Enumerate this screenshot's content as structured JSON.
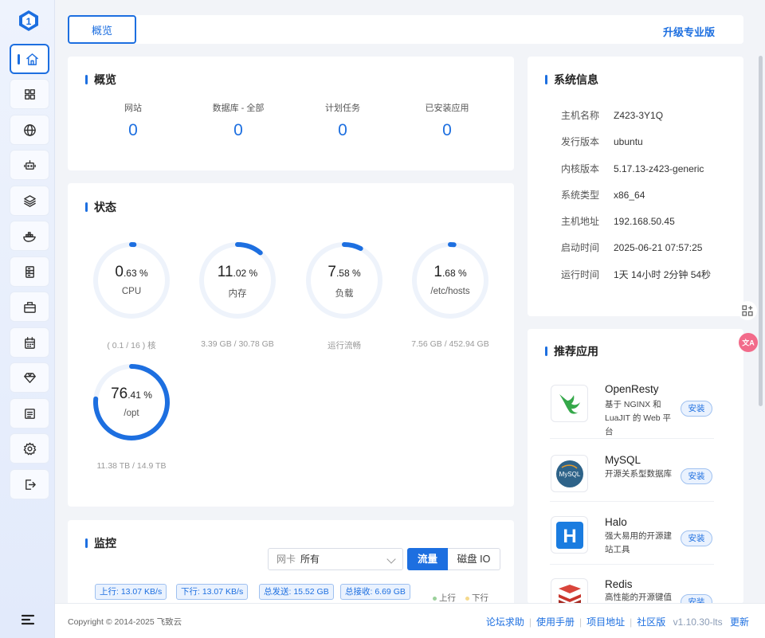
{
  "header": {
    "tab_overview": "概览",
    "upgrade": "升级专业版"
  },
  "overview": {
    "title": "概览",
    "stats": [
      {
        "label": "网站",
        "value": "0"
      },
      {
        "label": "数据库 - 全部",
        "value": "0"
      },
      {
        "label": "计划任务",
        "value": "0"
      },
      {
        "label": "已安装应用",
        "value": "0"
      }
    ]
  },
  "status": {
    "title": "状态",
    "gauges": [
      {
        "int": "0",
        "dec": ".63 %",
        "name": "CPU",
        "sub": "( 0.1 / 16 ) 核",
        "percent": 0.63
      },
      {
        "int": "11",
        "dec": ".02 %",
        "name": "内存",
        "sub": "3.39 GB / 30.78 GB",
        "percent": 11.02
      },
      {
        "int": "7",
        "dec": ".58 %",
        "name": "负载",
        "sub": "运行流畅",
        "percent": 7.58
      },
      {
        "int": "1",
        "dec": ".68 %",
        "name": "/etc/hosts",
        "sub": "7.56 GB / 452.94 GB",
        "percent": 1.68
      },
      {
        "int": "76",
        "dec": ".41 %",
        "name": "/opt",
        "sub": "11.38 TB / 14.9 TB",
        "percent": 76.41
      }
    ]
  },
  "sysinfo": {
    "title": "系统信息",
    "rows": [
      {
        "k": "主机名称",
        "v": "Z423-3Y1Q"
      },
      {
        "k": "发行版本",
        "v": "ubuntu"
      },
      {
        "k": "内核版本",
        "v": "5.17.13-z423-generic"
      },
      {
        "k": "系统类型",
        "v": "x86_64"
      },
      {
        "k": "主机地址",
        "v": "192.168.50.45"
      },
      {
        "k": "启动时间",
        "v": "2025-06-21 07:57:25"
      },
      {
        "k": "运行时间",
        "v": "1天 14小时 2分钟 54秒"
      }
    ]
  },
  "apps": {
    "title": "推荐应用",
    "install_label": "安装",
    "items": [
      {
        "name": "OpenResty",
        "desc": "基于 NGINX 和 LuaJIT 的 Web 平台"
      },
      {
        "name": "MySQL",
        "desc": "开源关系型数据库"
      },
      {
        "name": "Halo",
        "desc": "强大易用的开源建站工具"
      },
      {
        "name": "Redis",
        "desc": "高性能的开源键值"
      }
    ]
  },
  "monitor": {
    "title": "监控",
    "nic_placeholder": "网卡",
    "nic_value": "所有",
    "seg_traffic": "流量",
    "seg_disk": "磁盘 IO",
    "tags": [
      "上行: 13.07 KB/s",
      "下行: 13.07 KB/s",
      "总发送: 15.52 GB",
      "总接收: 6.69 GB"
    ],
    "legend_up": "上行",
    "legend_down": "下行"
  },
  "footer": {
    "copyright": "Copyright © 2014-2025 飞致云",
    "links": [
      "论坛求助",
      "使用手册",
      "项目地址",
      "社区版"
    ],
    "version": "v1.10.30-lts",
    "update": "更新"
  },
  "colors": {
    "accent": "#1d6fe0",
    "gauge_track": "#eef3fb"
  },
  "icons": {
    "nav": [
      "home-icon",
      "apps-icon",
      "globe-icon",
      "robot-icon",
      "layers-icon",
      "docker-icon",
      "database-icon",
      "toolbox-icon",
      "calendar-icon",
      "diamond-icon",
      "log-icon",
      "settings-icon",
      "logout-icon"
    ]
  }
}
